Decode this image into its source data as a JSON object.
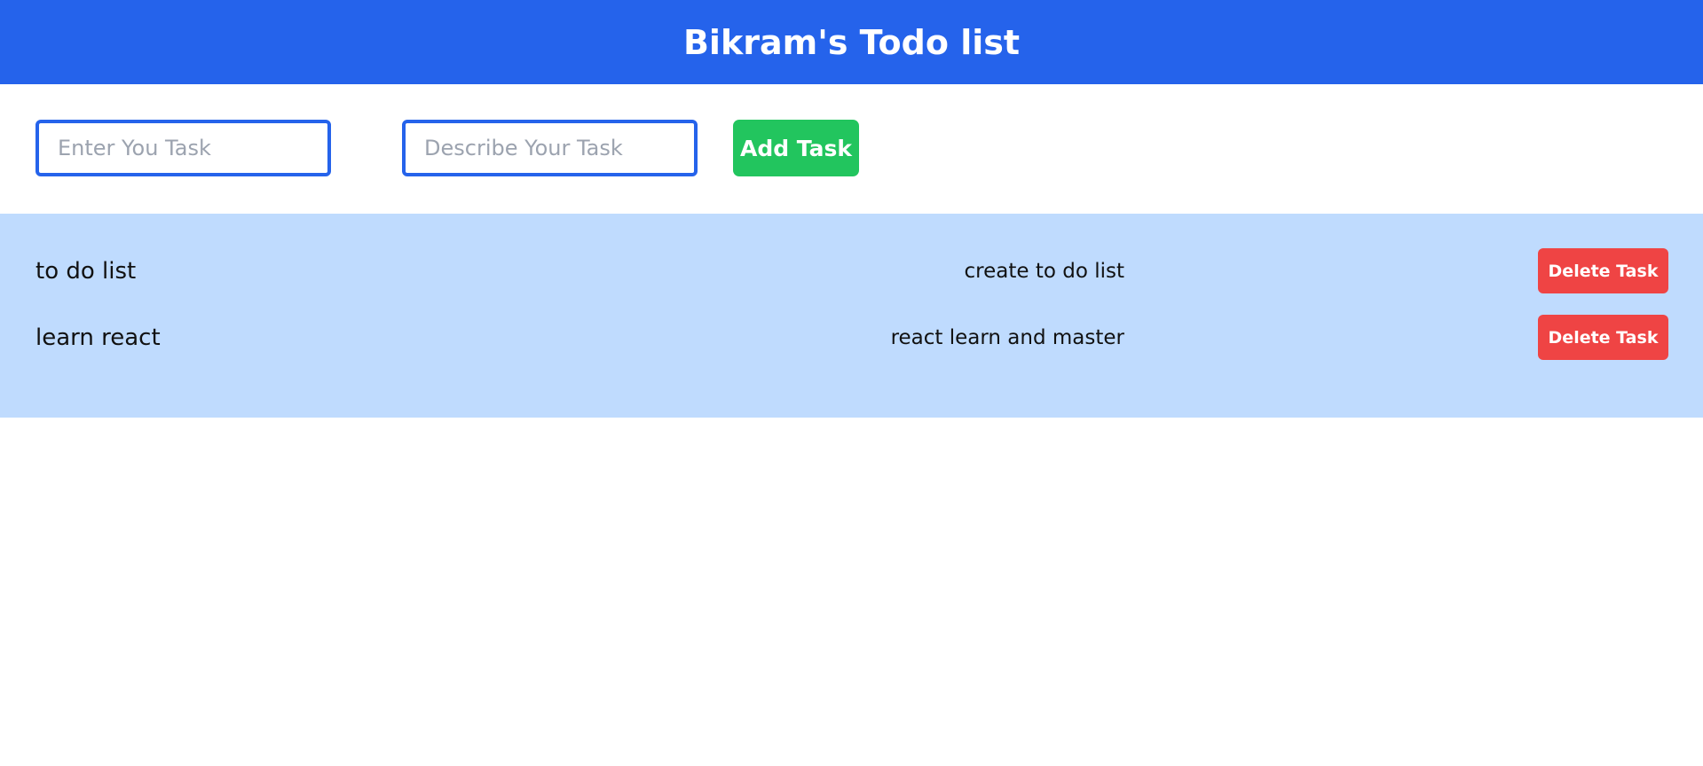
{
  "header": {
    "title": "Bikram's Todo list"
  },
  "form": {
    "title_placeholder": "Enter You Task",
    "title_value": "",
    "description_placeholder": "Describe Your Task",
    "description_value": "",
    "add_label": "Add Task"
  },
  "tasks": [
    {
      "title": "to do list",
      "description": "create to do list",
      "delete_label": "Delete Task"
    },
    {
      "title": "learn react",
      "description": "react learn and master",
      "delete_label": "Delete Task"
    }
  ],
  "colors": {
    "header_bg": "#2563eb",
    "input_border": "#2563eb",
    "add_button": "#22c55e",
    "list_bg": "#bfdbfe",
    "delete_button": "#ef4444"
  }
}
